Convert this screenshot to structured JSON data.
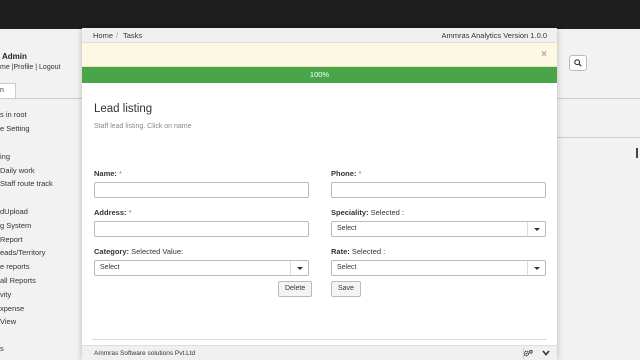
{
  "background": {
    "user_name": "Admin",
    "user_links": "me |Profile | Logout",
    "tab_label": "n",
    "menu_items": [
      "s in root",
      "e Setting",
      "ing",
      "Daily work",
      "Staff route track",
      "dUpload",
      "g System",
      "Report",
      "eads/Territory",
      "e reports",
      "all Reports",
      "vity",
      "xpense",
      "View",
      "s"
    ]
  },
  "modal": {
    "nav": {
      "home": "Home",
      "tasks": "Tasks",
      "version": "Ammras Analytics Version 1.0.0"
    },
    "alert_close": "×",
    "progress": {
      "label": "100%",
      "value": 1.0
    },
    "title": "Lead listing",
    "subtitle": "Staff lead listing. Click on name",
    "form": {
      "name": {
        "label": "Name:",
        "required": "*",
        "value": ""
      },
      "phone": {
        "label": "Phone:",
        "required": "*",
        "value": ""
      },
      "address": {
        "label": "Address:",
        "required": "*",
        "value": ""
      },
      "speciality": {
        "label": "Speciality:",
        "extra": "Selected :",
        "selected": "Select"
      },
      "category": {
        "label": "Category:",
        "extra": "Selected Value:",
        "selected": "Select"
      },
      "rate": {
        "label": "Rate:",
        "extra": "Selected :",
        "selected": "Select"
      },
      "delete_label": "Delete",
      "save_label": "Save"
    },
    "footer": {
      "company": "Ammras Software solutions Pvt.Ltd",
      "settings_icon": "gears-icon",
      "collapse_icon": "chevron-down-icon"
    }
  },
  "colors": {
    "progress": "#4aa54a",
    "alert_bg": "#fcf8e3",
    "topbar": "#1e1e1e"
  }
}
